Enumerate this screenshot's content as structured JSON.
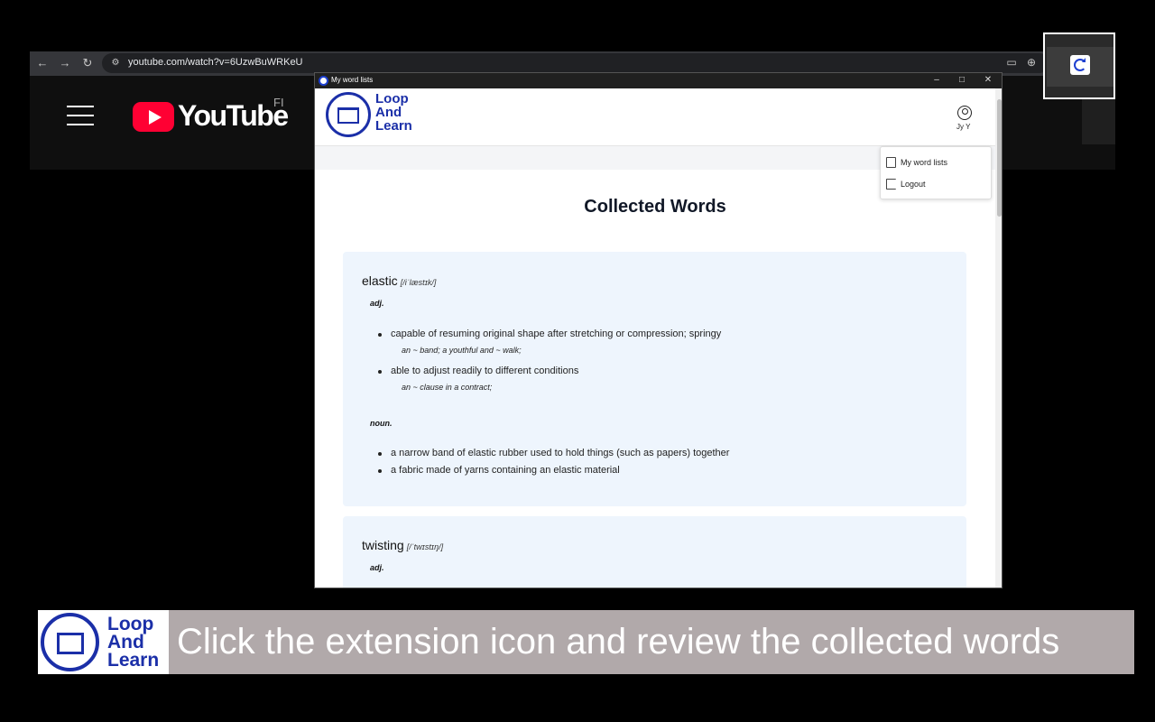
{
  "browser": {
    "url": "youtube.com/watch?v=6UzwBuWRKeU",
    "back_icon": "arrow-left-icon",
    "forward_icon": "arrow-right-icon",
    "reload_icon": "reload-icon"
  },
  "youtube": {
    "brand": "YouTube",
    "country": "FI"
  },
  "popup": {
    "window_title": "My word lists",
    "brand_lines": [
      "Loop",
      "And",
      "Learn"
    ],
    "user_name": "Jy Y",
    "menu": {
      "word_lists": "My word lists",
      "logout": "Logout"
    },
    "page_title": "Collected Words",
    "words": [
      {
        "word": "elastic",
        "phonetic": "[/iˈlæstɪk/]",
        "groups": [
          {
            "pos": "adj.",
            "definitions": [
              {
                "text": "capable of resuming original shape after stretching or compression; springy",
                "example": "an ~ band; a youthful and ~ walk;"
              },
              {
                "text": "able to adjust readily to different conditions",
                "example": "an ~ clause in a contract;"
              }
            ]
          },
          {
            "pos": "noun.",
            "definitions": [
              {
                "text": "a narrow band of elastic rubber used to hold things (such as papers) together"
              },
              {
                "text": "a fabric made of yarns containing an elastic material"
              }
            ]
          }
        ]
      },
      {
        "word": "twisting",
        "phonetic": "[/ˈtwɪstɪŋ/]",
        "groups": [
          {
            "pos": "adj."
          }
        ]
      }
    ]
  },
  "banner": {
    "brand_lines": [
      "Loop",
      "And",
      "Learn"
    ],
    "caption": "Click the extension icon and review the collected words"
  },
  "colors": {
    "brand_blue": "#1b2fa8",
    "card_bg": "#eef5fd",
    "youtube_red": "#ff0033",
    "caption_bg": "#b1a9aa"
  }
}
